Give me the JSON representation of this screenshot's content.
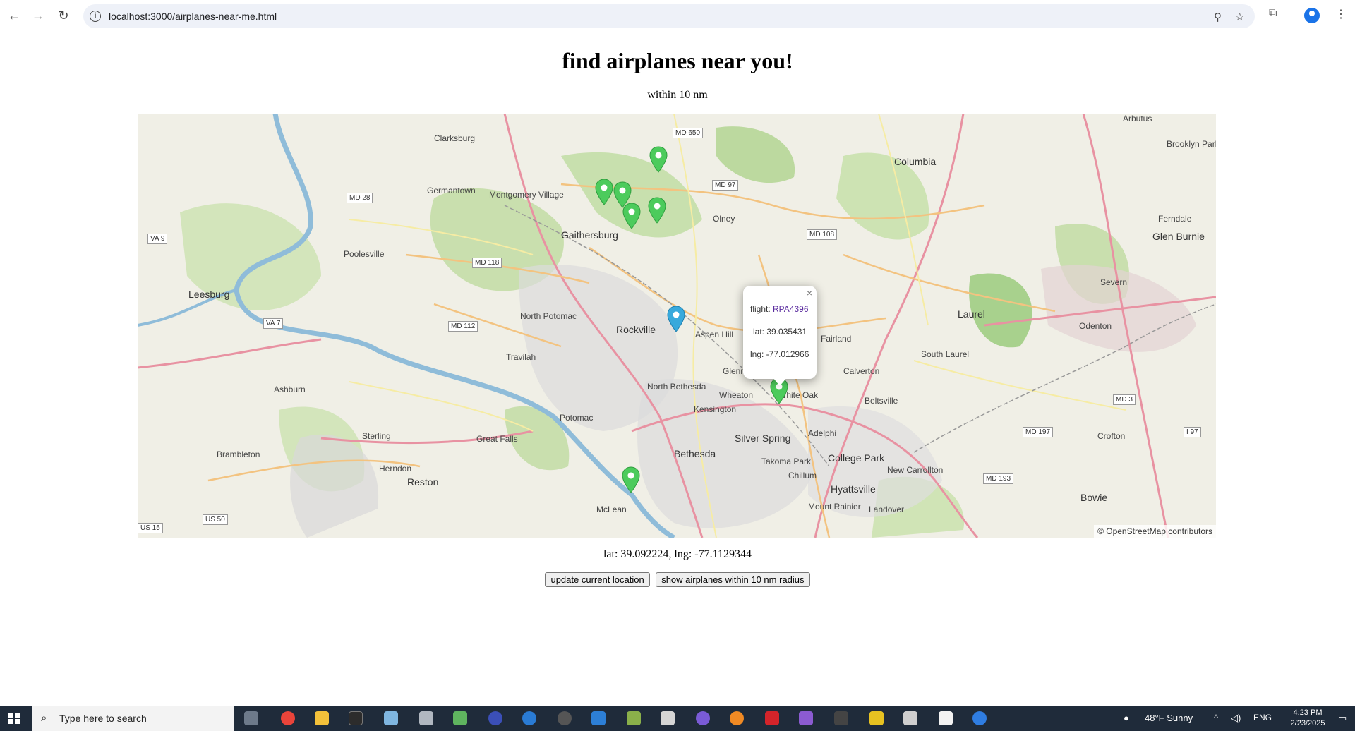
{
  "browser": {
    "url": "localhost:3000/airplanes-near-me.html",
    "back_icon": "arrow-left-icon",
    "forward_icon": "arrow-right-icon",
    "reload_icon": "reload-icon"
  },
  "page": {
    "title": "find airplanes near you!",
    "subtitle": "within 10 nm",
    "coords_text": "lat: 39.092224, lng: -77.1129344",
    "update_button": "update current location",
    "show_button": "show airplanes within 10 nm radius"
  },
  "map": {
    "attribution": "© OpenStreetMap contributors",
    "popup": {
      "close": "×",
      "flight_label": "flight: ",
      "flight_value": "RPA4396",
      "lat_text": "lat: 39.035431",
      "lng_text": "lng: -77.012966"
    },
    "places": [
      "Clarksburg",
      "Germantown",
      "Montgomery Village",
      "Gaithersburg",
      "Olney",
      "Columbia",
      "Leesburg",
      "Poolesville",
      "North Potomac",
      "Rockville",
      "Aspen Hill",
      "Laurel",
      "Fairland",
      "South Laurel",
      "Travilah",
      "North Bethesda",
      "Wheaton",
      "White Oak",
      "Calverton",
      "Beltsville",
      "Ashburn",
      "Potomac",
      "Kensington",
      "Silver Spring",
      "Adelphi",
      "Sterling",
      "Great Falls",
      "Bethesda",
      "Takoma Park",
      "College Park",
      "Herndon",
      "Reston",
      "Chillum",
      "Hyattsville",
      "New Carrollton",
      "Brambleton",
      "McLean",
      "Mount Rainier",
      "Landover",
      "Bowie",
      "Crofton",
      "Odenton",
      "Severn",
      "Glen Burnie",
      "Ferndale",
      "Brooklyn Park",
      "Arbutus",
      "Glenn"
    ],
    "shields": [
      "MD 650",
      "MD 97",
      "MD 28",
      "MD 108",
      "VA 9",
      "MD 118",
      "VA 7",
      "MD 112",
      "MD 3",
      "MD 197",
      "MD 193",
      "US 50",
      "US 15",
      "I 97"
    ]
  },
  "taskbar": {
    "search_placeholder": "Type here to search",
    "weather": "48°F  Sunny",
    "lang": "ENG",
    "time": "4:23 PM",
    "date": "2/23/2025"
  }
}
